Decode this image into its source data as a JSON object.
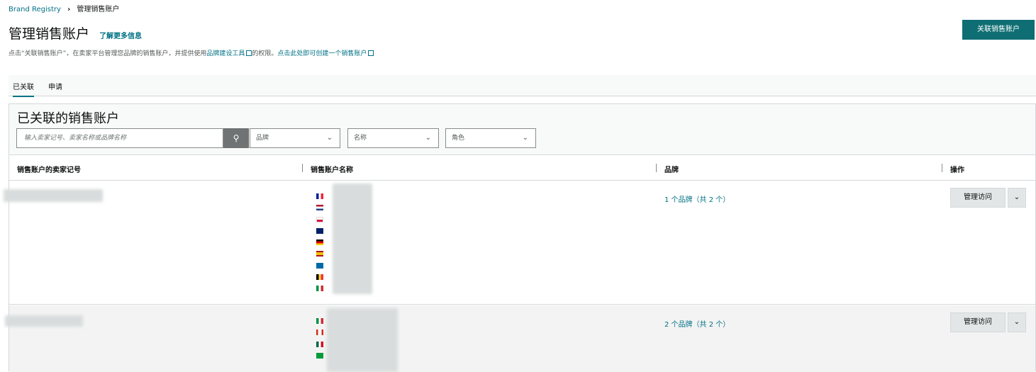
{
  "breadcrumb": {
    "root": "Brand Registry",
    "current": "管理销售账户"
  },
  "header": {
    "title": "管理销售账户",
    "more_info": "了解更多信息",
    "link_button": "关联销售账户"
  },
  "description": {
    "part1": "点击“关联销售账户”，在卖家平台管理您品牌的销售账户，并提供使用",
    "tools_link": "品牌建设工具",
    "part2": "的权限。",
    "create_link": "点击此处即可创建一个销售账户"
  },
  "tabs": [
    {
      "label": "已关联",
      "active": true
    },
    {
      "label": "申请",
      "active": false
    }
  ],
  "panel": {
    "title": "已关联的销售账户",
    "search_placeholder": "输入卖家记号、卖家名称或品牌名称",
    "filters": [
      "品牌",
      "名称",
      "角色"
    ]
  },
  "table": {
    "headers": [
      "销售账户的卖家记号",
      "销售账户名称",
      "品牌",
      "操作"
    ],
    "rows": [
      {
        "brands": "1 个品牌（共 2 个）",
        "action": "管理访问",
        "flags": [
          "fr",
          "nl",
          "pl",
          "uk",
          "de",
          "es",
          "se",
          "be",
          "it"
        ]
      },
      {
        "brands": "2 个品牌（共 2 个）",
        "action": "管理访问",
        "flags": [
          "it",
          "ca",
          "mx",
          "br"
        ]
      }
    ]
  },
  "icons": {
    "search": "search-icon",
    "chevron": "chevron-down-icon",
    "external": "external-link-icon"
  },
  "colors": {
    "accent": "#0e6e73",
    "link": "#007185"
  }
}
